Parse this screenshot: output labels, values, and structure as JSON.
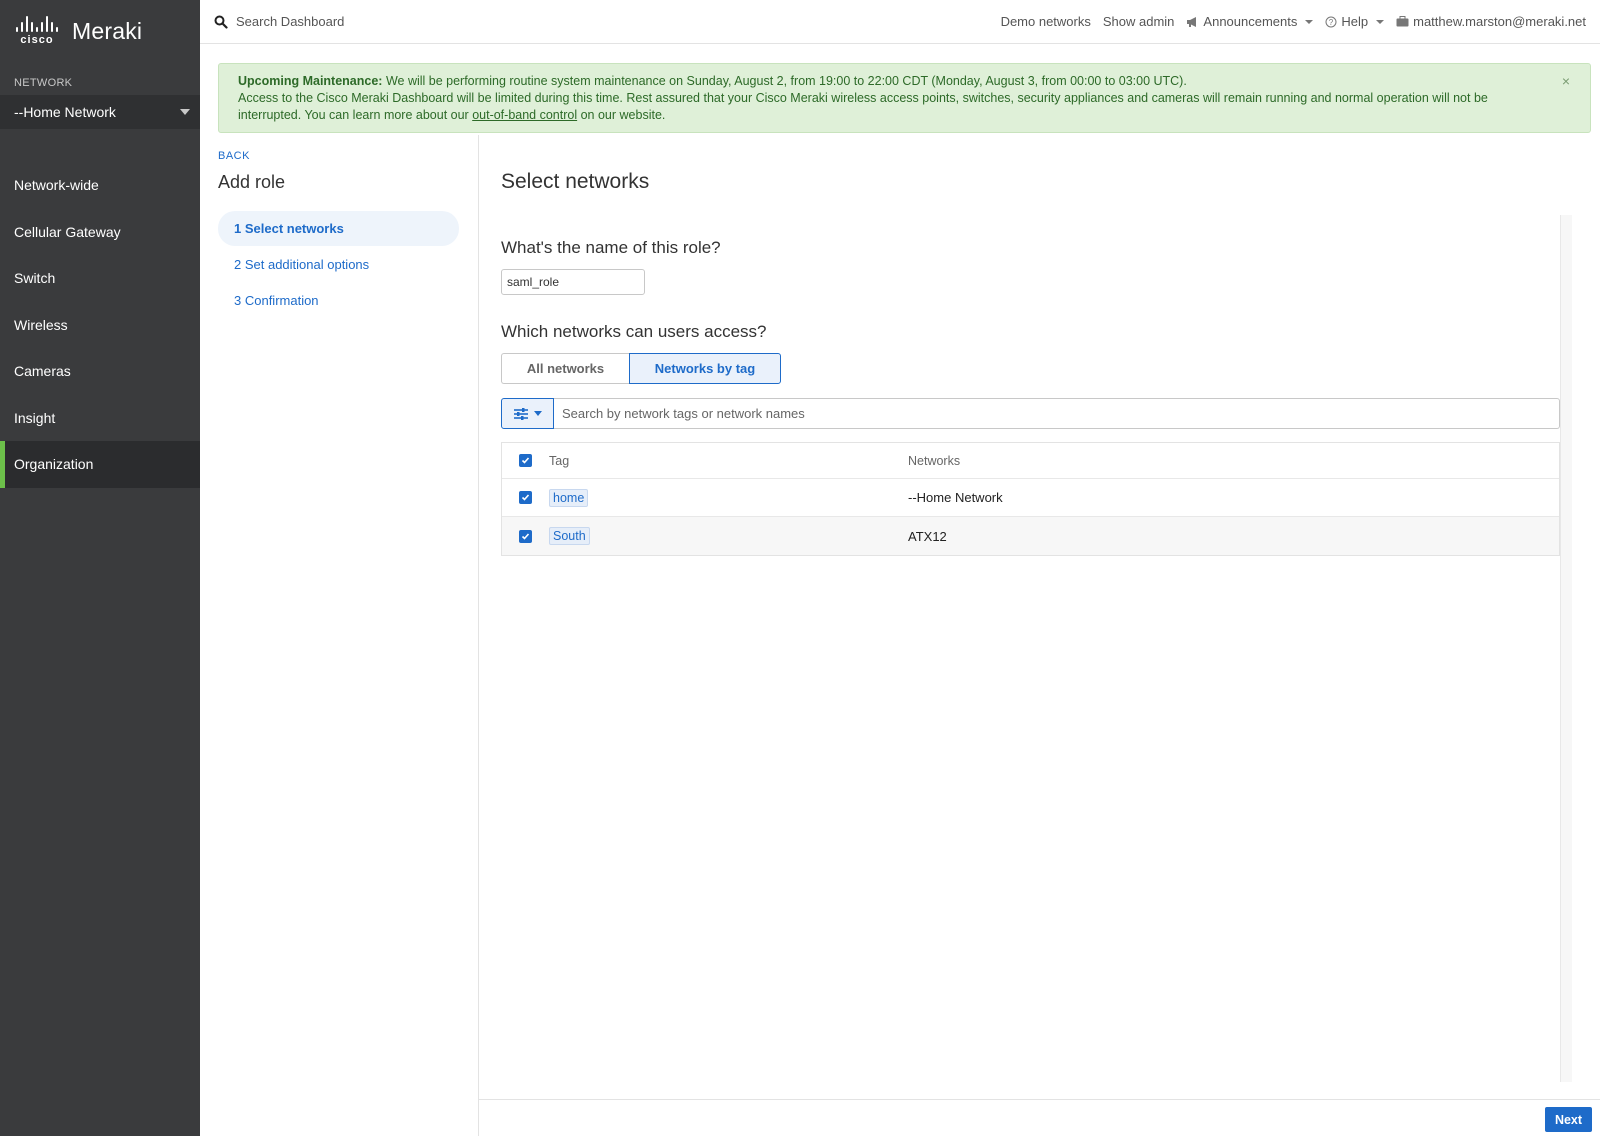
{
  "brand": {
    "cisco": "cisco",
    "product": "Meraki"
  },
  "sidebar": {
    "network_label": "NETWORK",
    "network_selected": "--Home Network",
    "items": [
      {
        "label": "Network-wide"
      },
      {
        "label": "Cellular Gateway"
      },
      {
        "label": "Switch"
      },
      {
        "label": "Wireless"
      },
      {
        "label": "Cameras"
      },
      {
        "label": "Insight"
      },
      {
        "label": "Organization",
        "active": true
      }
    ]
  },
  "topbar": {
    "search_label": "Search Dashboard",
    "demo_networks": "Demo networks",
    "show_admin": "Show admin",
    "announcements": "Announcements",
    "help": "Help",
    "user": "matthew.marston@meraki.net"
  },
  "banner": {
    "bold": "Upcoming Maintenance:",
    "line1": " We will be performing routine system maintenance on Sunday, August 2, from 19:00 to 22:00 CDT (Monday, August 3, from 00:00 to 03:00 UTC).",
    "line2": "Access to the Cisco Meraki Dashboard will be limited during this time. Rest assured that your Cisco Meraki wireless access points, switches, security appliances and cameras will remain running and normal operation will not be interrupted. You can learn more about our ",
    "link": "out-of-band control",
    "line3": " on our website.",
    "close": "×"
  },
  "wizard": {
    "back": "BACK",
    "title": "Add role",
    "steps": [
      {
        "label": "1 Select networks",
        "active": true
      },
      {
        "label": "2 Set additional options"
      },
      {
        "label": "3 Confirmation"
      }
    ]
  },
  "main": {
    "title": "Select networks",
    "name_question": "What's the name of this role?",
    "role_name": "saml_role",
    "access_question": "Which networks can users access?",
    "toggle": {
      "all": "All networks",
      "by_tag": "Networks by tag",
      "selected": "by_tag"
    },
    "search_placeholder": "Search by network tags or network names",
    "table": {
      "headers": {
        "tag": "Tag",
        "networks": "Networks"
      },
      "rows": [
        {
          "tag": "home",
          "network": "--Home Network",
          "checked": true
        },
        {
          "tag": "South",
          "network": "ATX12",
          "checked": true
        }
      ]
    }
  },
  "footer": {
    "next": "Next"
  },
  "colors": {
    "accent": "#1e6bc9",
    "sidebar": "#3a3b3d",
    "active_indicator": "#6cc04a",
    "banner_bg": "#dff0d8"
  }
}
